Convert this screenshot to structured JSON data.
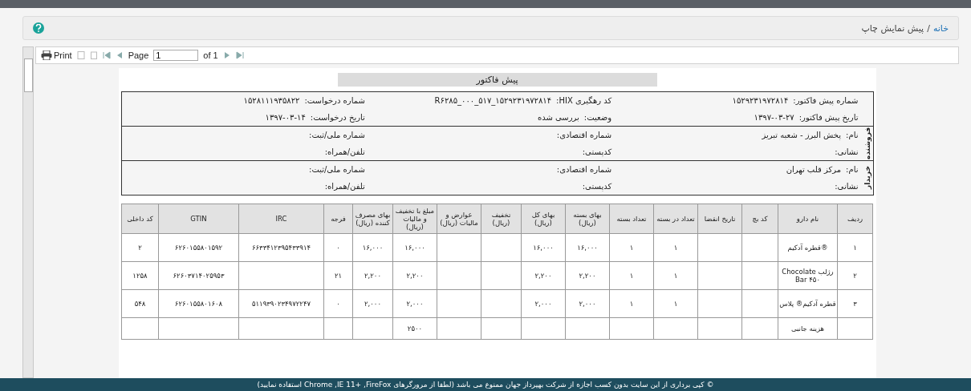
{
  "breadcrumb": {
    "home": "خانه",
    "separator": "/",
    "current": "پیش نمایش چاپ"
  },
  "toolbar": {
    "print": "Print",
    "page_label": "Page",
    "page_value": "1",
    "of": "of 1"
  },
  "report": {
    "title": "پیش فاکتور",
    "header": [
      {
        "label": "شماره پیش فاکتور:",
        "value": "۱۵۲۹۲۳۱۹۷۲۸۱۴"
      },
      {
        "label": "کد رهگیری HIX:",
        "value": "۱۵۲۹۲۳۱۹۷۲۸۱۴_۵۱۷_۰۰۰_R۶۲۸۵"
      },
      {
        "label": "شماره درخواست:",
        "value": "۱۵۲۸۱۱۱۹۳۵۸۲۲"
      },
      {
        "label": "تاریخ پیش فاکتور:",
        "value": "۱۳۹۷-۰۳-۲۷"
      },
      {
        "label": "وضعیت:",
        "value": "بررسی شده"
      },
      {
        "label": "تاریخ درخواست:",
        "value": "۱۳۹۷-۰۳-۱۴"
      }
    ],
    "parties": [
      {
        "role": "فروشنده",
        "fields": [
          {
            "label": "نام:",
            "value": "پخش البرز - شعبه تبریز"
          },
          {
            "label": "شماره اقتصادی:"
          },
          {
            "label": "شماره ملی/ثبت:"
          },
          {
            "label": "نشانی:"
          },
          {
            "label": "کدپستی:"
          },
          {
            "label": "تلفن/همراه:"
          }
        ]
      },
      {
        "role": "خریدار",
        "fields": [
          {
            "label": "نام:",
            "value": "مرکز قلب تهران"
          },
          {
            "label": "شماره اقتصادی:"
          },
          {
            "label": "شماره ملی/ثبت:"
          },
          {
            "label": "نشانی:"
          },
          {
            "label": "کدپستی:"
          },
          {
            "label": "تلفن/همراه:"
          }
        ]
      }
    ],
    "table": {
      "columns": [
        "ردیف",
        "نام دارو",
        "کد بچ",
        "تاریخ انقضا",
        "تعداد در بسته",
        "تعداد بسته",
        "بهای بسته (ریال)",
        "بهای کل (ریال)",
        "تخفیف (ریال)",
        "عوارض و مالیات (ریال)",
        "مبلغ با تخفیف و مالیات (ریال)",
        "بهای مصرف کننده (ریال)",
        "فرجه",
        "IRC",
        "GTIN",
        "کد داخلی"
      ],
      "rows": [
        [
          "۱",
          "®قطره آدکیم",
          null,
          null,
          "۱",
          "۱",
          "۱۶,۰۰۰",
          "۱۶,۰۰۰",
          null,
          null,
          "۱۶,۰۰۰",
          "۱۶,۰۰۰",
          "۰",
          "۶۶۳۳۴۱۲۳۹۵۴۳۳۹۱۴",
          "۶۲۶۰۱۵۵۸۰۱۵۹۲",
          "۲"
        ],
        [
          "۲",
          "رژلب Chocolate Bar ۴۵۰",
          null,
          null,
          "۱",
          "۱",
          "۲,۲۰۰",
          "۲,۲۰۰",
          null,
          null,
          "۲,۲۰۰",
          "۲,۲۰۰",
          "۲۱",
          null,
          "۶۲۶۰۳۷۱۴۰۲۵۹۵۳",
          "۱۲۵۸"
        ],
        [
          "۳",
          "قطره آدکیم® پلاس",
          null,
          null,
          "۱",
          "۱",
          "۲,۰۰۰",
          "۲,۰۰۰",
          null,
          null,
          "۲,۰۰۰",
          "۲,۰۰۰",
          "۰",
          "۵۱۱۹۳۹۰۲۳۴۹۷۲۲۴۷",
          "۶۲۶۰۱۵۵۸۰۱۶۰۸",
          "۵۴۸"
        ],
        [
          null,
          "هزینه جانبی",
          null,
          null,
          null,
          null,
          null,
          null,
          null,
          null,
          "۲۵۰۰",
          null,
          null,
          null,
          null,
          null
        ]
      ]
    }
  },
  "footer": "© کپی برداری از این سایت بدون کسب اجازه از شرکت بهپرداز جهان ممنوع می باشد (لطفا از مرورگرهای Chrome ,IE 11+ ,FireFox استفاده نمایید)"
}
